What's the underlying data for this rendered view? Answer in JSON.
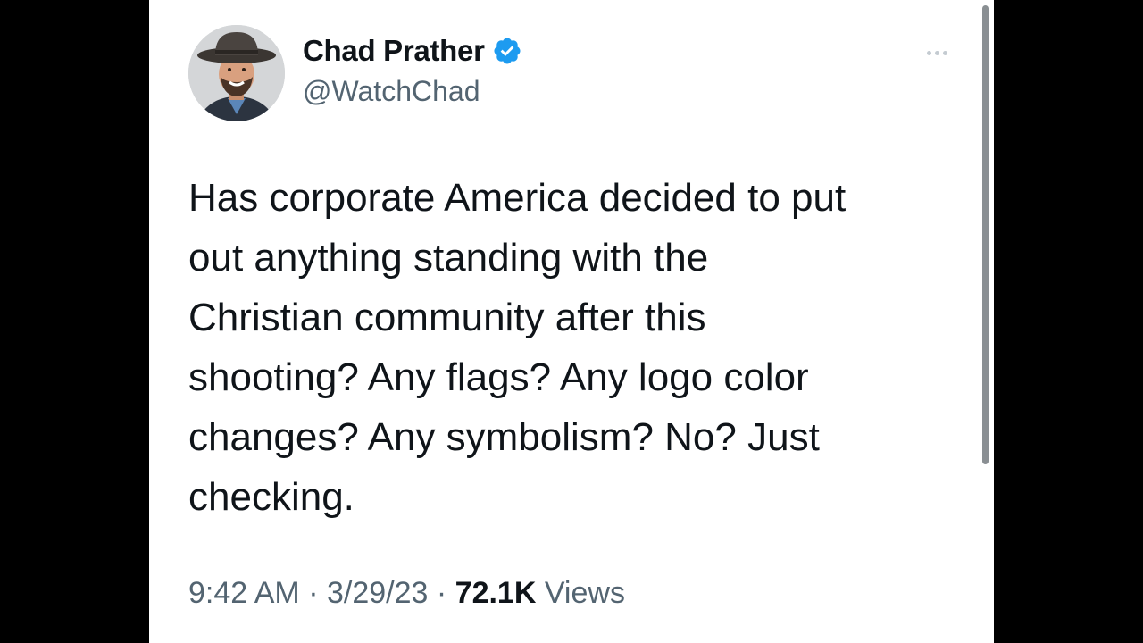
{
  "tweet": {
    "author": {
      "display_name": "Chad Prather",
      "handle": "@WatchChad",
      "verified": true
    },
    "text": "Has corporate America decided to put\nout anything standing with the\nChristian community after this\nshooting? Any flags? Any logo color\nchanges? Any symbolism? No? Just\nchecking.",
    "time": "9:42 AM",
    "separator": "·",
    "date": "3/29/23",
    "views_count": "72.1K",
    "views_label": "Views"
  },
  "icons": {
    "verified": "verified-badge-icon",
    "more": "more-options-icon"
  },
  "colors": {
    "background": "#000000",
    "card": "#ffffff",
    "primary_text": "#0f1419",
    "secondary_text": "#536471",
    "verified_blue": "#1d9bf0"
  }
}
